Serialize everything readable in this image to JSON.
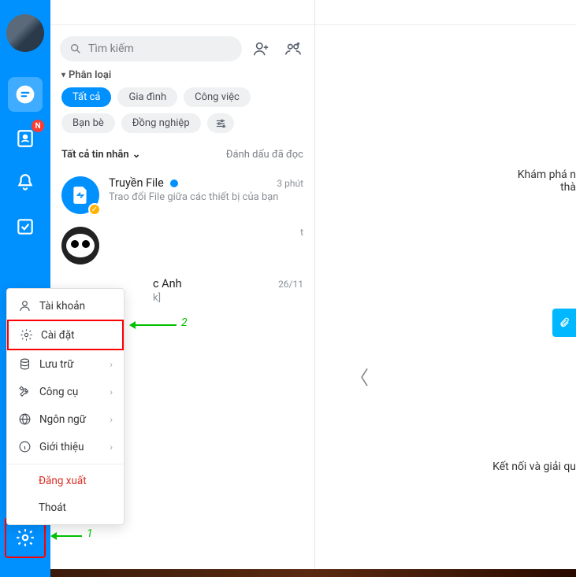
{
  "leftRail": {
    "badge_contacts": "N"
  },
  "search": {
    "placeholder": "Tìm kiếm"
  },
  "categories": {
    "header": "Phân loại",
    "chips": {
      "all": "Tất cả",
      "family": "Gia đình",
      "work": "Công việc",
      "friends": "Bạn bè",
      "colleagues": "Đồng nghiệp"
    }
  },
  "msgHeader": {
    "left": "Tất cả tin nhắn",
    "right": "Đánh dấu đã đọc"
  },
  "conversations": [
    {
      "title": "Truyền File",
      "subtitle": "Trao đổi File giữa các thiết bị của bạn",
      "time": "3 phút",
      "unread": true
    },
    {
      "title": "",
      "subtitle": "",
      "time": "t"
    },
    {
      "title": "c Anh",
      "subtitle": "k]",
      "time": "26/11"
    }
  ],
  "settingsMenu": {
    "account": "Tài khoản",
    "settings": "Cài đặt",
    "storage": "Lưu trữ",
    "tools": "Công cụ",
    "language": "Ngôn ngữ",
    "about": "Giới thiệu",
    "logout": "Đăng xuất",
    "exit": "Thoát"
  },
  "rightPanel": {
    "line1a": "Khám phá n",
    "line1b": "thà",
    "line2": "Kết nối và giải qu"
  },
  "annotations": {
    "step1": "1",
    "step2": "2"
  }
}
